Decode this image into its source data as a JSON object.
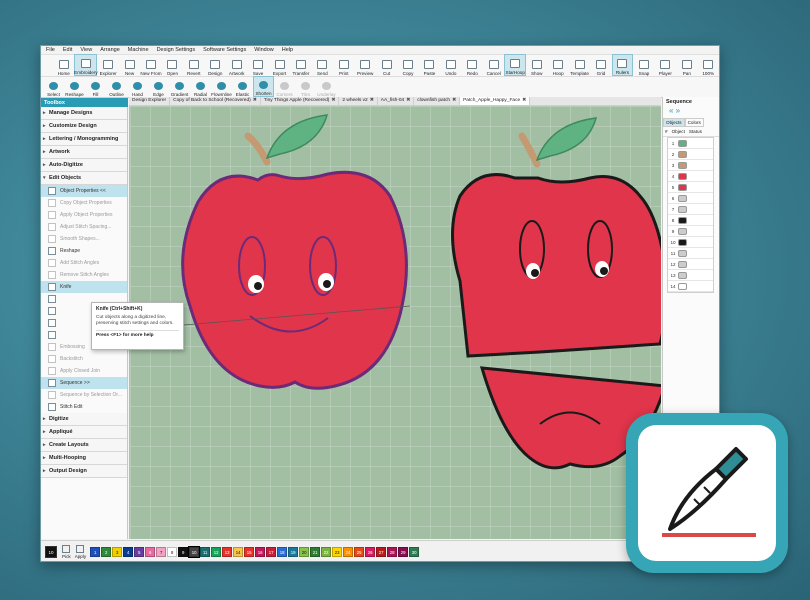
{
  "menu": [
    "File",
    "Edit",
    "View",
    "Arrange",
    "Machine",
    "Design Settings",
    "Software Settings",
    "Window",
    "Help"
  ],
  "ribbon1": [
    "Home",
    "Embroidery",
    "Explorer",
    "New",
    "New From",
    "Open",
    "Revert",
    "Design",
    "Artwork",
    "Save",
    "Export",
    "Transfer",
    "Send",
    "Print",
    "Preview",
    "Cut",
    "Copy",
    "Paste",
    "Undo",
    "Redo",
    "Cancel",
    "StarHoop",
    "Show",
    "Hoop",
    "Template",
    "Grid",
    "Rulers",
    "Snap",
    "Player",
    "Pan",
    "100%"
  ],
  "ribbon2": [
    "Select",
    "Reshape",
    "Fill",
    "Outline",
    "Hand",
    "Edge",
    "Gradient",
    "Radial",
    "Flowmline",
    "Elastic",
    "Shorten",
    "Corners",
    "Trim",
    "Underlay"
  ],
  "toolbox": {
    "title": "Toolbox",
    "sections_top": [
      "Manage Designs",
      "Customize Design",
      "Lettering / Monogramming",
      "Artwork",
      "Auto-Digitize",
      "Edit Objects"
    ],
    "edit_items": [
      "Object Properties <<",
      "Copy Object Properties",
      "Apply Object Properties",
      "Adjust Stitch Spacing...",
      "Smooth Shapes...",
      "Reshape",
      "Add Stitch Angles",
      "Remove Stitch Angles",
      "Knife"
    ],
    "more_items": [
      "Embossing",
      "Backstitch",
      "Apply Closed Join",
      "Sequence >>",
      "Sequence by Selection Or...",
      "Stitch Edit"
    ],
    "sections_bottom": [
      "Digitize",
      "Appliqué",
      "Create Layouts",
      "Multi-Hooping",
      "Output Design"
    ]
  },
  "tooltip": {
    "title": "Knife (Ctrl+Shift+K)",
    "desc": "Cut objects along a digitized line, preserving stitch settings and colors.",
    "help": "Press <F1> for more help"
  },
  "tabs": [
    "Design Explorer",
    "Copy of Back to School (Recovered)",
    "Tiny Things Apple (Recovered)",
    "2 wheels v2",
    "AA_fish-04",
    "clownfish patch",
    "Patch_Apple_Happy_Face"
  ],
  "tab_close": "✖",
  "sequence": {
    "title": "Sequence",
    "arrows": "«  »",
    "tabs": [
      "Objects",
      "Colors"
    ],
    "headers": [
      "#",
      "Object",
      "Status"
    ],
    "rows": [
      "1",
      "2",
      "3",
      "4",
      "5",
      "6",
      "7",
      "8",
      "9",
      "10",
      "11",
      "12",
      "13",
      "14"
    ]
  },
  "palette": {
    "current": "10",
    "tools": [
      "Pick",
      "Apply"
    ],
    "swatches": [
      "1",
      "2",
      "3",
      "4",
      "5",
      "6",
      "7",
      "8",
      "9",
      "10",
      "11",
      "12",
      "13",
      "14",
      "15",
      "16",
      "17",
      "18",
      "19",
      "20",
      "21",
      "22",
      "23",
      "24",
      "25",
      "26",
      "27",
      "28",
      "29",
      "30"
    ]
  },
  "colors": {
    "accent": "#2a9bb4",
    "apple_red": "#e0354b",
    "leaf_green": "#5fb383",
    "stem": "#c49a72",
    "outline_purple": "#6d2a78",
    "outline_black": "#1a1a1a",
    "background": "#a2bfa4"
  },
  "icons": [
    "knife-icon",
    "scissors-icon",
    "reshape-icon",
    "sequence-icon"
  ]
}
